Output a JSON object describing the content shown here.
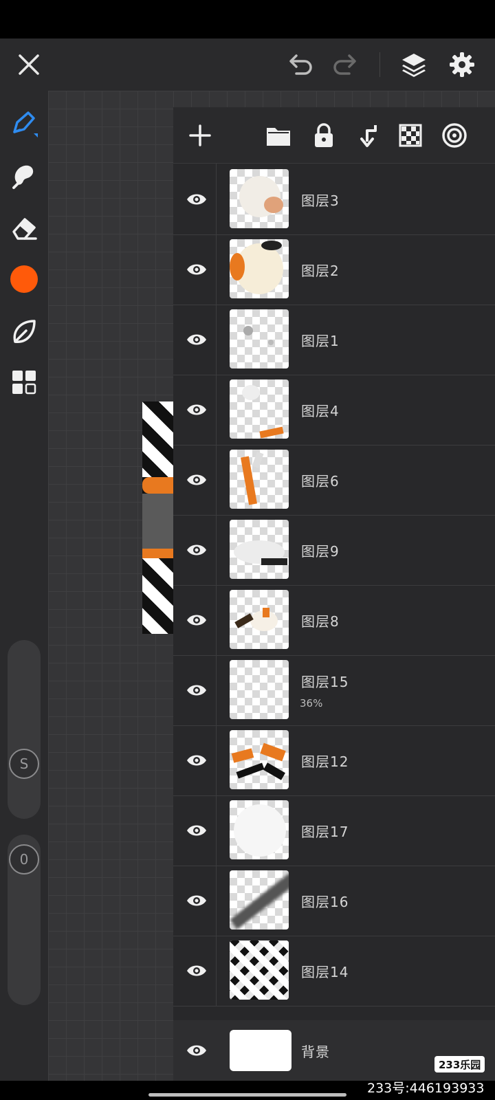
{
  "app": {
    "accent": "#2f8cf0",
    "current_color": "#ff5a0a"
  },
  "topbar": {
    "icons": [
      "close-icon",
      "undo-icon",
      "redo-icon",
      "layers-icon",
      "gear-icon"
    ]
  },
  "sidebar": {
    "tools": [
      "brush-icon",
      "smudge-icon",
      "eraser-icon",
      "color-swatch",
      "leaf-icon",
      "grid-icon"
    ],
    "size_knob": "S",
    "opacity_knob": "0"
  },
  "layers_toolbar": {
    "icons": [
      "plus-icon",
      "folder-icon",
      "lock-icon",
      "merge-down-icon",
      "checker-icon",
      "target-icon"
    ]
  },
  "layers": [
    {
      "name": "图层3",
      "opacity": ""
    },
    {
      "name": "图层2",
      "opacity": ""
    },
    {
      "name": "图层1",
      "opacity": ""
    },
    {
      "name": "图层4",
      "opacity": ""
    },
    {
      "name": "图层6",
      "opacity": ""
    },
    {
      "name": "图层9",
      "opacity": ""
    },
    {
      "name": "图层8",
      "opacity": ""
    },
    {
      "name": "图层15",
      "opacity": "36%"
    },
    {
      "name": "图层12",
      "opacity": ""
    },
    {
      "name": "图层17",
      "opacity": ""
    },
    {
      "name": "图层16",
      "opacity": ""
    },
    {
      "name": "图层14",
      "opacity": ""
    }
  ],
  "background_layer": {
    "name": "背景"
  },
  "watermark": {
    "logo": "233乐园",
    "id": "233号:446193933"
  }
}
